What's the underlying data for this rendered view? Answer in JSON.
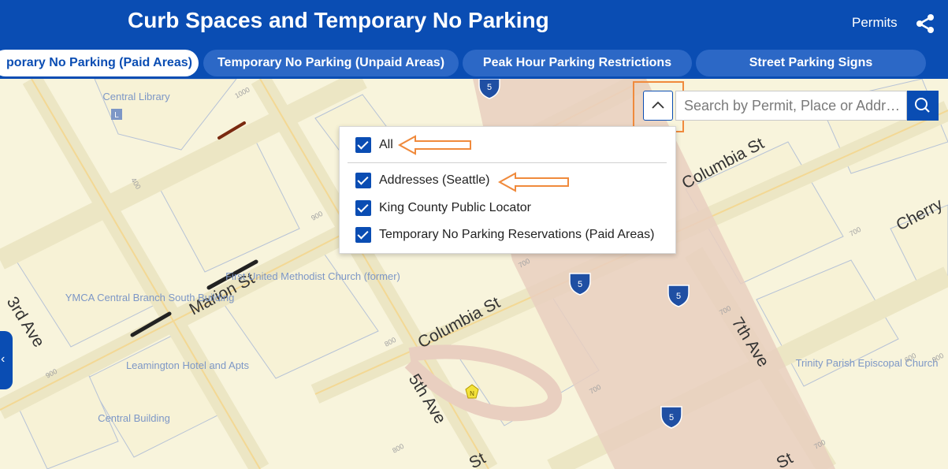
{
  "header": {
    "title": "Curb Spaces and Temporary No Parking",
    "permits_label": "Permits",
    "share_icon": "share-icon"
  },
  "tabs": [
    {
      "label": "porary No Parking (Paid Areas)",
      "active": true
    },
    {
      "label": "Temporary No Parking (Unpaid Areas)",
      "active": false
    },
    {
      "label": "Peak Hour Parking Restrictions",
      "active": false
    },
    {
      "label": "Street Parking Signs",
      "active": false
    }
  ],
  "search": {
    "placeholder": "Search by Permit, Place or Addr…",
    "collapse_icon": "chevron-up-icon",
    "search_icon": "search-icon"
  },
  "dropdown": {
    "items": [
      {
        "label": "All",
        "checked": true
      },
      {
        "label": "Addresses (Seattle)",
        "checked": true
      },
      {
        "label": "King County Public Locator",
        "checked": true
      },
      {
        "label": "Temporary No Parking Reservations (Paid Areas)",
        "checked": true
      }
    ]
  },
  "map": {
    "streets": [
      "Columbia St",
      "Columbia St",
      "Marion St",
      "3rd Ave",
      "5th Ave",
      "7th Ave",
      "Cherry",
      "St",
      "St"
    ],
    "places": [
      "Central Library",
      "First United Methodist Church (former)",
      "YMCA Central Branch South Building",
      "Leamington Hotel and Apts",
      "Central Building",
      "Trinity Parish Episcopal Church"
    ],
    "address_numbers": [
      "1000",
      "400",
      "900",
      "900",
      "800",
      "700",
      "700",
      "800",
      "700",
      "700",
      "600",
      "700",
      "900"
    ],
    "shields": [
      "5",
      "5",
      "5",
      "5"
    ],
    "library_marker": "L",
    "poi_marker": "N",
    "colors": {
      "header": "#0a4db3",
      "annotation": "#f08a3c",
      "map_bg": "#f8f4dc",
      "freeway": "#e9cfc0"
    }
  }
}
